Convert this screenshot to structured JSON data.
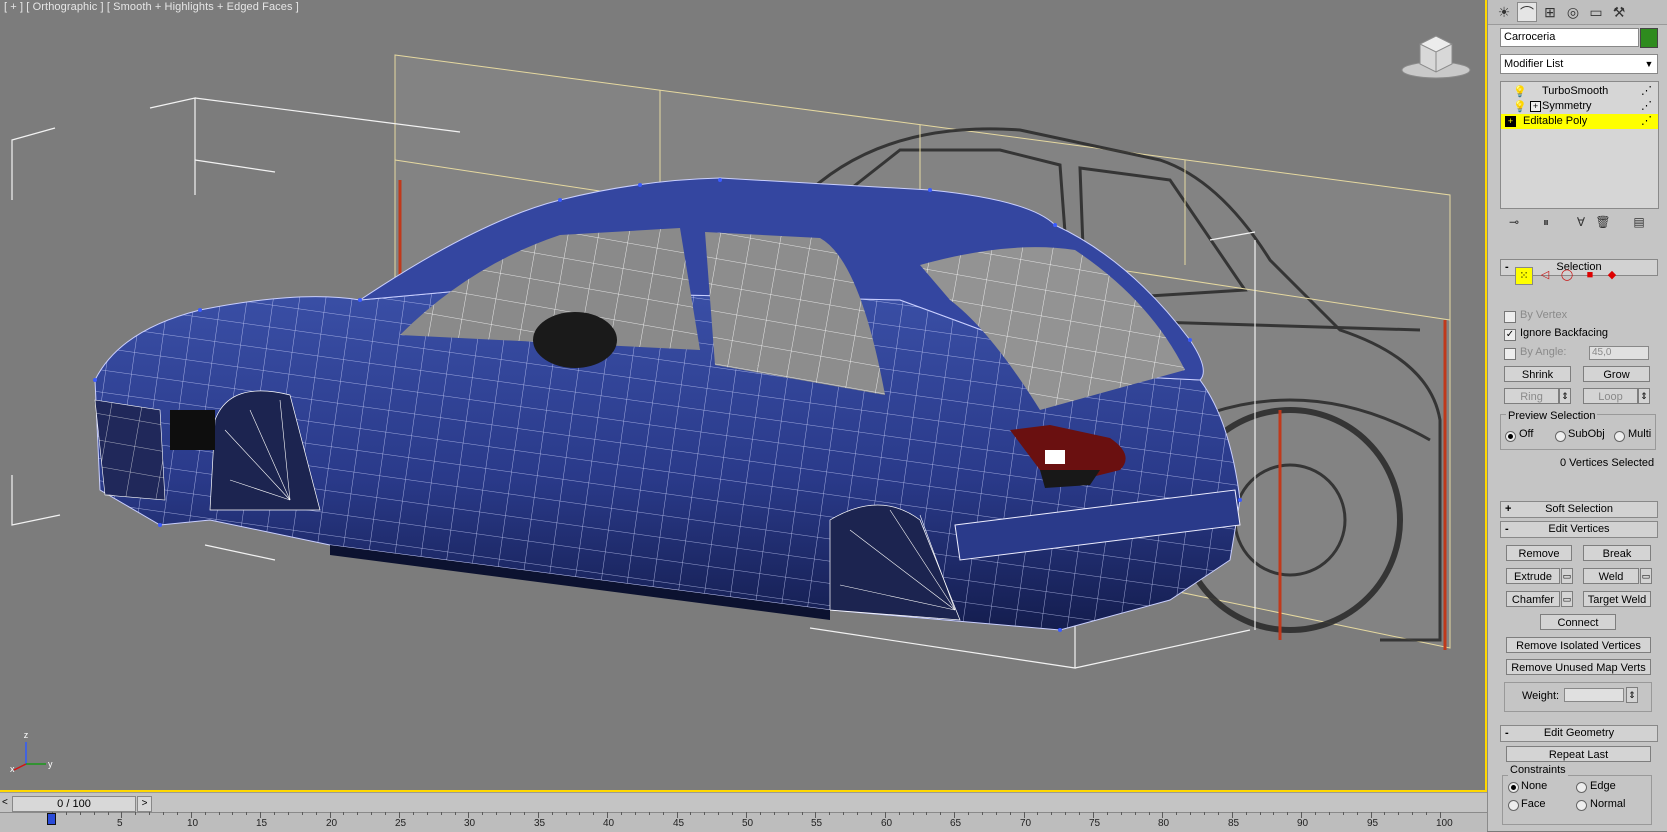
{
  "viewport": {
    "label": "[ + ] [ Orthographic ] [ Smooth + Highlights + Edged Faces ]",
    "viewcube_icon": "viewcube-icon",
    "axis_labels": {
      "z": "z",
      "x": "x",
      "y": "y"
    }
  },
  "timeline": {
    "slider_text": "0 / 100",
    "prev": "<",
    "next": ">",
    "ticks": [
      "5",
      "10",
      "15",
      "20",
      "25",
      "30",
      "35",
      "40",
      "45",
      "50",
      "55",
      "60",
      "65",
      "70",
      "75",
      "80",
      "85",
      "90",
      "95",
      "100"
    ]
  },
  "panel": {
    "tabs": [
      "create-icon",
      "modify-icon",
      "hierarchy-icon",
      "motion-icon",
      "display-icon",
      "utilities-icon"
    ],
    "object_name": "Carroceria",
    "object_color": "#2e8b1e",
    "modifier_list": "Modifier List",
    "stack": [
      {
        "label": "TurboSmooth",
        "selected": false
      },
      {
        "label": "Symmetry",
        "selected": false
      },
      {
        "label": "Editable Poly",
        "selected": true
      }
    ],
    "selection": {
      "title": "Selection",
      "by_vertex": "By Vertex",
      "ignore_backfacing": "Ignore Backfacing",
      "by_angle": "By Angle:",
      "angle_value": "45,0",
      "shrink": "Shrink",
      "grow": "Grow",
      "ring": "Ring",
      "loop": "Loop",
      "preview_title": "Preview Selection",
      "preview_off": "Off",
      "preview_subobj": "SubObj",
      "preview_multi": "Multi",
      "status": "0 Vertices Selected"
    },
    "soft_selection": {
      "title": "Soft Selection"
    },
    "edit_vertices": {
      "title": "Edit Vertices",
      "remove": "Remove",
      "break": "Break",
      "extrude": "Extrude",
      "weld": "Weld",
      "chamfer": "Chamfer",
      "target_weld": "Target Weld",
      "connect": "Connect",
      "remove_isolated": "Remove Isolated Vertices",
      "remove_unused": "Remove Unused Map Verts",
      "weight": "Weight:"
    },
    "edit_geometry": {
      "title": "Edit Geometry",
      "repeat_last": "Repeat Last",
      "constraints": "Constraints",
      "none": "None",
      "edge": "Edge",
      "face": "Face",
      "normal": "Normal"
    }
  }
}
